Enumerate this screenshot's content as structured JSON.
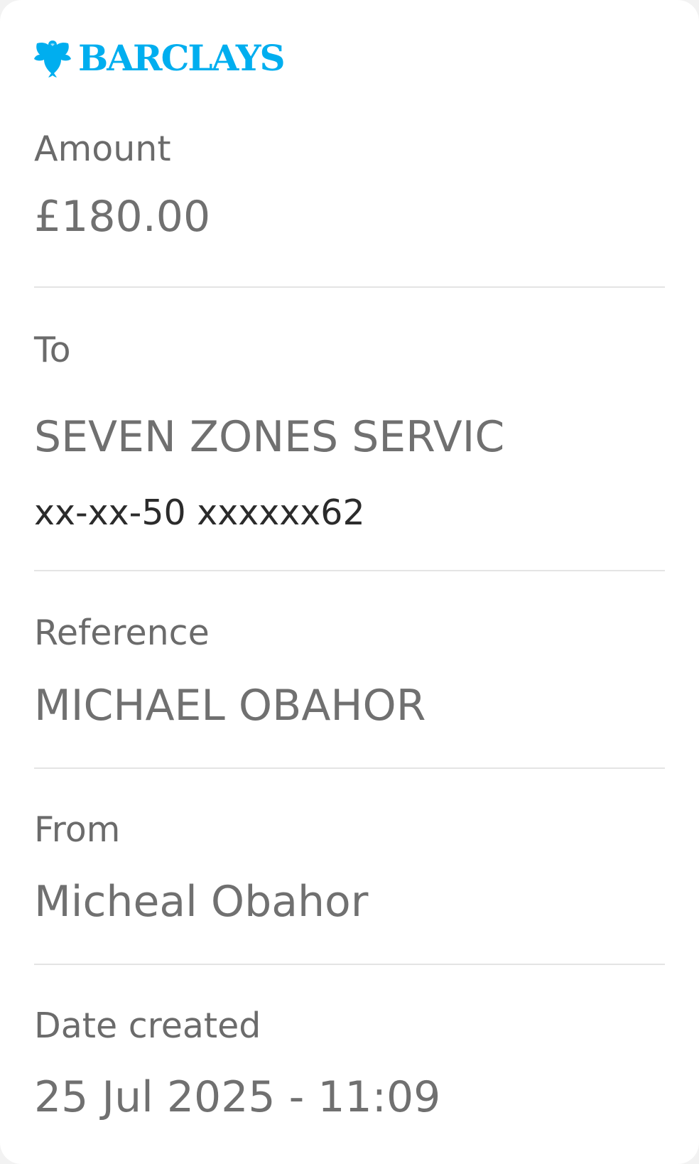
{
  "brand": {
    "name": "BARCLAYS",
    "color": "#00aeef"
  },
  "amount": {
    "label": "Amount",
    "value": "£180.00"
  },
  "to": {
    "label": "To",
    "name": "SEVEN ZONES SERVIC",
    "account": "xx-xx-50 xxxxxx62"
  },
  "reference": {
    "label": "Reference",
    "value": "MICHAEL OBAHOR"
  },
  "from": {
    "label": "From",
    "value": "Micheal Obahor"
  },
  "date_created": {
    "label": "Date created",
    "value": "25 Jul 2025 - 11:09"
  },
  "colors": {
    "label_text": "#6b6b6b",
    "value_text": "#707070",
    "account_text": "#2b2b2b",
    "divider": "#e4e4e4"
  }
}
